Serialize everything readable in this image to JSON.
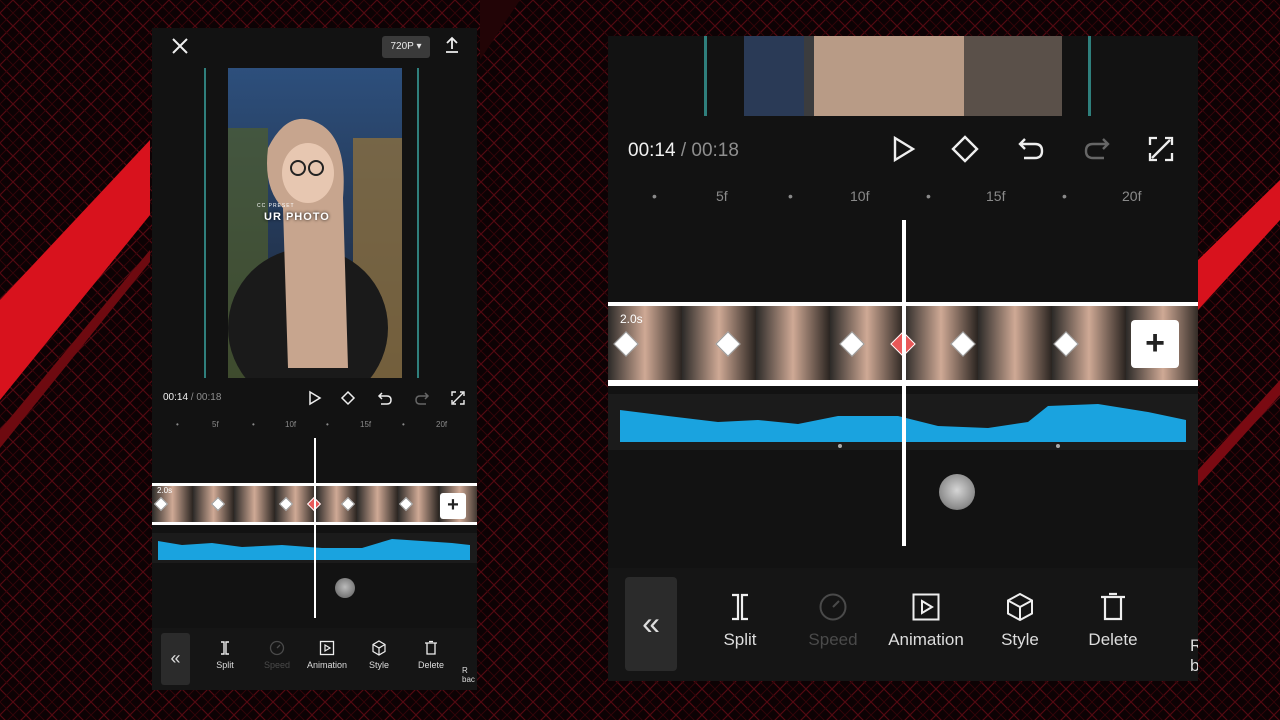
{
  "editor": {
    "resolution": "720P",
    "current_time": "00:14",
    "separator": " / ",
    "total_time": "00:18",
    "clip_duration": "2.0s",
    "ruler_labels": [
      "5f",
      "10f",
      "15f",
      "20f"
    ],
    "watermark_title": "UR PHOTO",
    "watermark_small": "CC PRESET",
    "add_clip": "+",
    "back_glyph": "«",
    "tools": {
      "split": "Split",
      "speed": "Speed",
      "animation": "Animation",
      "style": "Style",
      "delete": "Delete",
      "partial_line1": "R",
      "partial_line2": "bac"
    }
  },
  "icons": {
    "close": "close-icon",
    "export": "export-icon",
    "play": "play-icon",
    "keyframe": "keyframe-icon",
    "undo": "undo-icon",
    "redo": "redo-icon",
    "fullscreen": "fullscreen-icon"
  },
  "colors": {
    "accent_teal": "#2f7f7c",
    "audio_wave": "#1aa3df",
    "keyframe_active": "#e85858",
    "background_red": "#c0141e"
  }
}
